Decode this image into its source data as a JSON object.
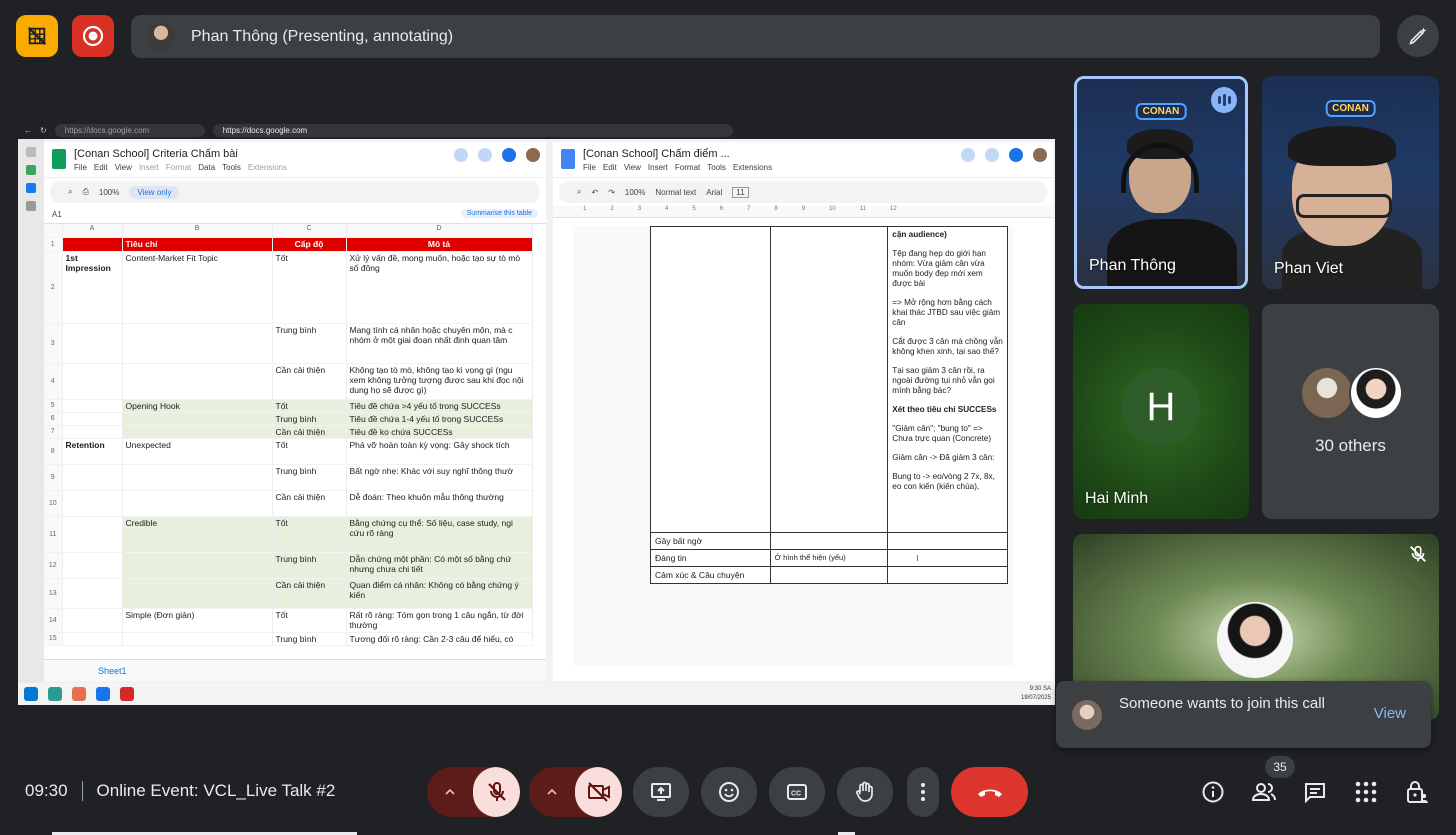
{
  "top": {
    "presenter_text": "Phan Thông (Presenting, annotating)",
    "colors": {
      "hide_btn": "#f9ab00",
      "record_btn": "#d93025"
    }
  },
  "shared_screen": {
    "browser_url_1": "https://docs.google.com",
    "browser_url_2": "https://docs.google.com",
    "sheet": {
      "title": "[Conan School] Criteria Chấm bài",
      "menu": [
        "File",
        "Edit",
        "View",
        "Insert",
        "Format",
        "Data",
        "Tools",
        "Extensions"
      ],
      "zoom": "100%",
      "view_only": "View only",
      "cell_ref": "A1",
      "summarise": "Summarise this table",
      "columns": [
        "A",
        "B",
        "C",
        "D"
      ],
      "header_row": [
        "",
        "Tiêu chí",
        "Cấp độ",
        "Mô tả"
      ],
      "rows": [
        {
          "n": "2",
          "a": "1st Impression",
          "b": "Content-Market Fit Topic",
          "c": "Tốt",
          "d": "Xử lý vấn đề, mong muốn, hoặc tạo sự tò mò số đông"
        },
        {
          "n": "3",
          "a": "",
          "b": "",
          "c": "Trung bình",
          "d": "Mang tính cá nhân hoặc chuyên môn, mà c nhóm ở một giai đoạn nhất định quan tâm"
        },
        {
          "n": "4",
          "a": "",
          "b": "",
          "c": "Cần cải thiện",
          "d": "Không tạo tò mò, không tạo kì vọng gì (ngu xem không tưởng tượng được sau khi đọc nội dung họ sẽ được gì)"
        },
        {
          "n": "5",
          "a": "",
          "b": "Opening Hook",
          "c": "Tốt",
          "d": "Tiêu đề chứa >4 yếu tố trong SUCCESs"
        },
        {
          "n": "6",
          "a": "",
          "b": "",
          "c": "Trung bình",
          "d": "Tiêu đề chứa 1-4 yếu tố trong SUCCESs"
        },
        {
          "n": "7",
          "a": "",
          "b": "",
          "c": "Cần cải thiện",
          "d": "Tiêu đề ko chứa SUCCESs"
        },
        {
          "n": "8",
          "a": "Retention",
          "b": "Unexpected",
          "c": "Tốt",
          "d": "Phá vỡ hoàn toàn kỳ vọng: Gây shock tích"
        },
        {
          "n": "9",
          "a": "",
          "b": "",
          "c": "Trung bình",
          "d": "Bất ngờ nhẹ: Khác với suy nghĩ thông thườ"
        },
        {
          "n": "10",
          "a": "",
          "b": "",
          "c": "Cần cải thiện",
          "d": "Dễ đoán: Theo khuôn mẫu thông thường"
        },
        {
          "n": "11",
          "a": "",
          "b": "Credible",
          "c": "Tốt",
          "d": "Bằng chứng cụ thể: Số liệu, case study, ngi cứu rõ ràng"
        },
        {
          "n": "12",
          "a": "",
          "b": "",
          "c": "Trung bình",
          "d": "Dẫn chứng một phần: Có một số bằng chứ nhưng chưa chi tiết"
        },
        {
          "n": "13",
          "a": "",
          "b": "",
          "c": "Cần cải thiện",
          "d": "Quan điểm cá nhân: Không có bằng chứng ý kiến"
        },
        {
          "n": "14",
          "a": "",
          "b": "Simple (Đơn giản)",
          "c": "Tốt",
          "d": "Rất rõ ràng: Tóm gọn trong 1 câu ngắn, từ đời thường"
        },
        {
          "n": "15",
          "a": "",
          "b": "",
          "c": "Trung bình",
          "d": "Tương đối rõ ràng: Cần 2-3 câu để hiểu, có"
        }
      ],
      "tab_name": "Sheet1"
    },
    "doc": {
      "title": "[Conan School] Chấm điểm ...",
      "menu": [
        "File",
        "Edit",
        "View",
        "Insert",
        "Format",
        "Tools",
        "Extensions"
      ],
      "zoom": "100%",
      "style": "Normal text",
      "font": "Arial",
      "font_size": "11",
      "col3_paragraphs": [
        "cận audience)",
        "Tệp đang hẹp do giới hạn nhóm: Vừa giảm cân vừa muốn body đẹp mới xem được bài",
        "=> Mở rộng hơn bằng cách khai thác JTBD sau việc giảm cân",
        "Cắt được 3 cân mà chồng vẫn không khen xinh, tại sao thế?",
        "Tại sao giảm 3 cân rồi, ra ngoài đường tụi nhỏ vẫn gọi mình bằng bác?",
        "Xét theo tiêu chí SUCCESs",
        "\"Giảm cân\"; \"bung to\" => Chưa trực quan (Concrete)",
        "Giảm cân -> Đã giảm 3 cân:",
        "Bung to -> eo/vòng 2 7x, 8x, eo con kiến (kiến chúa),"
      ],
      "rows": [
        {
          "c1": "Gây bất ngờ",
          "c2": "",
          "c3": ""
        },
        {
          "c1": "Đáng tin",
          "c2": "Ở hình thể hiện (yếu)",
          "c3": "I"
        },
        {
          "c1": "Cảm xúc & Câu chuyện",
          "c2": "",
          "c3": ""
        }
      ]
    },
    "clock_time": "9:30 SA",
    "clock_date": "19/07/2025"
  },
  "participants": {
    "tile1": {
      "name": "Phan Thông",
      "sign": "CONAN"
    },
    "tile2": {
      "name": "Phan Viet",
      "sign": "CONAN"
    },
    "tile3": {
      "name": "Hai Minh",
      "initial": "H"
    },
    "tile4": {
      "label": "30 others"
    }
  },
  "toast": {
    "message": "Someone wants to join this call",
    "action": "View"
  },
  "bottom": {
    "time": "09:30",
    "meeting_name": "Online Event: VCL_Live Talk #2",
    "participant_count": "35"
  }
}
